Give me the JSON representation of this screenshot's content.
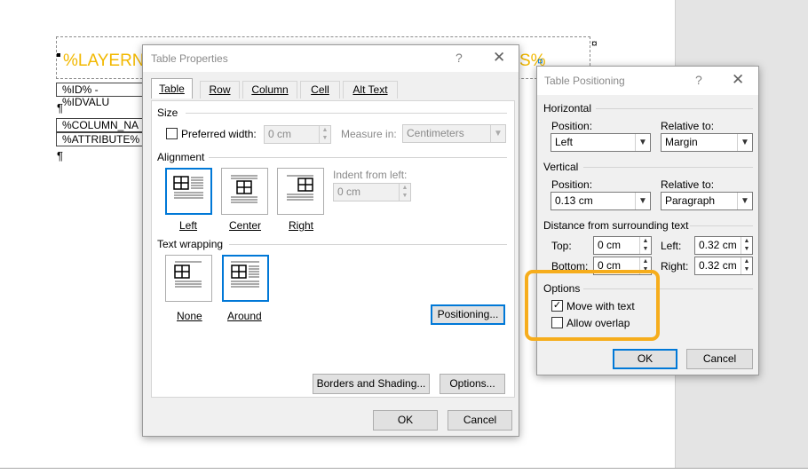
{
  "document": {
    "header_text_left": "%LAYERNA",
    "header_text_right": "S%",
    "row1": "%ID% - %IDVALU",
    "row2": "%COLUMN_NA",
    "row3": "%ATTRIBUTE%",
    "pilcrow": "¶",
    "cell_marker": "¤",
    "anchor_marker": "¤"
  },
  "table_properties": {
    "title": "Table Properties",
    "help": "?",
    "close": "✕",
    "tabs": [
      {
        "label": "Table",
        "active": true
      },
      {
        "label": "Row",
        "active": false
      },
      {
        "label": "Column",
        "active": false
      },
      {
        "label": "Cell",
        "active": false
      },
      {
        "label": "Alt Text",
        "active": false
      }
    ],
    "size": {
      "section": "Size",
      "preferred_width_label": "Preferred width:",
      "preferred_width_checked": false,
      "preferred_width_value": "0 cm",
      "measure_in_label": "Measure in:",
      "measure_in_value": "Centimeters"
    },
    "alignment": {
      "section": "Alignment",
      "options": [
        "Left",
        "Center",
        "Right"
      ],
      "selected": "Left",
      "indent_label": "Indent from left:",
      "indent_value": "0 cm"
    },
    "text_wrapping": {
      "section": "Text wrapping",
      "options": [
        "None",
        "Around"
      ],
      "selected": "Around"
    },
    "positioning_button": "Positioning...",
    "borders_button": "Borders and Shading...",
    "options_button": "Options...",
    "ok": "OK",
    "cancel": "Cancel"
  },
  "table_positioning": {
    "title": "Table Positioning",
    "help": "?",
    "close": "✕",
    "horizontal": {
      "section": "Horizontal",
      "position_label": "Position:",
      "position_value": "Left",
      "relative_label": "Relative to:",
      "relative_value": "Margin"
    },
    "vertical": {
      "section": "Vertical",
      "position_label": "Position:",
      "position_value": "0.13 cm",
      "relative_label": "Relative to:",
      "relative_value": "Paragraph"
    },
    "distance": {
      "section": "Distance from surrounding text",
      "top_label": "Top:",
      "top_value": "0 cm",
      "bottom_label": "Bottom:",
      "bottom_value": "0 cm",
      "left_label": "Left:",
      "left_value": "0.32 cm",
      "right_label": "Right:",
      "right_value": "0.32 cm"
    },
    "options": {
      "section": "Options",
      "move_with_text": "Move with text",
      "move_with_text_checked": true,
      "allow_overlap": "Allow overlap",
      "allow_overlap_checked": false
    },
    "ok": "OK",
    "cancel": "Cancel",
    "highlight_color": "#f6ad1c"
  },
  "colors": {
    "accent": "#0078d7",
    "field_code": "#f2b800"
  }
}
